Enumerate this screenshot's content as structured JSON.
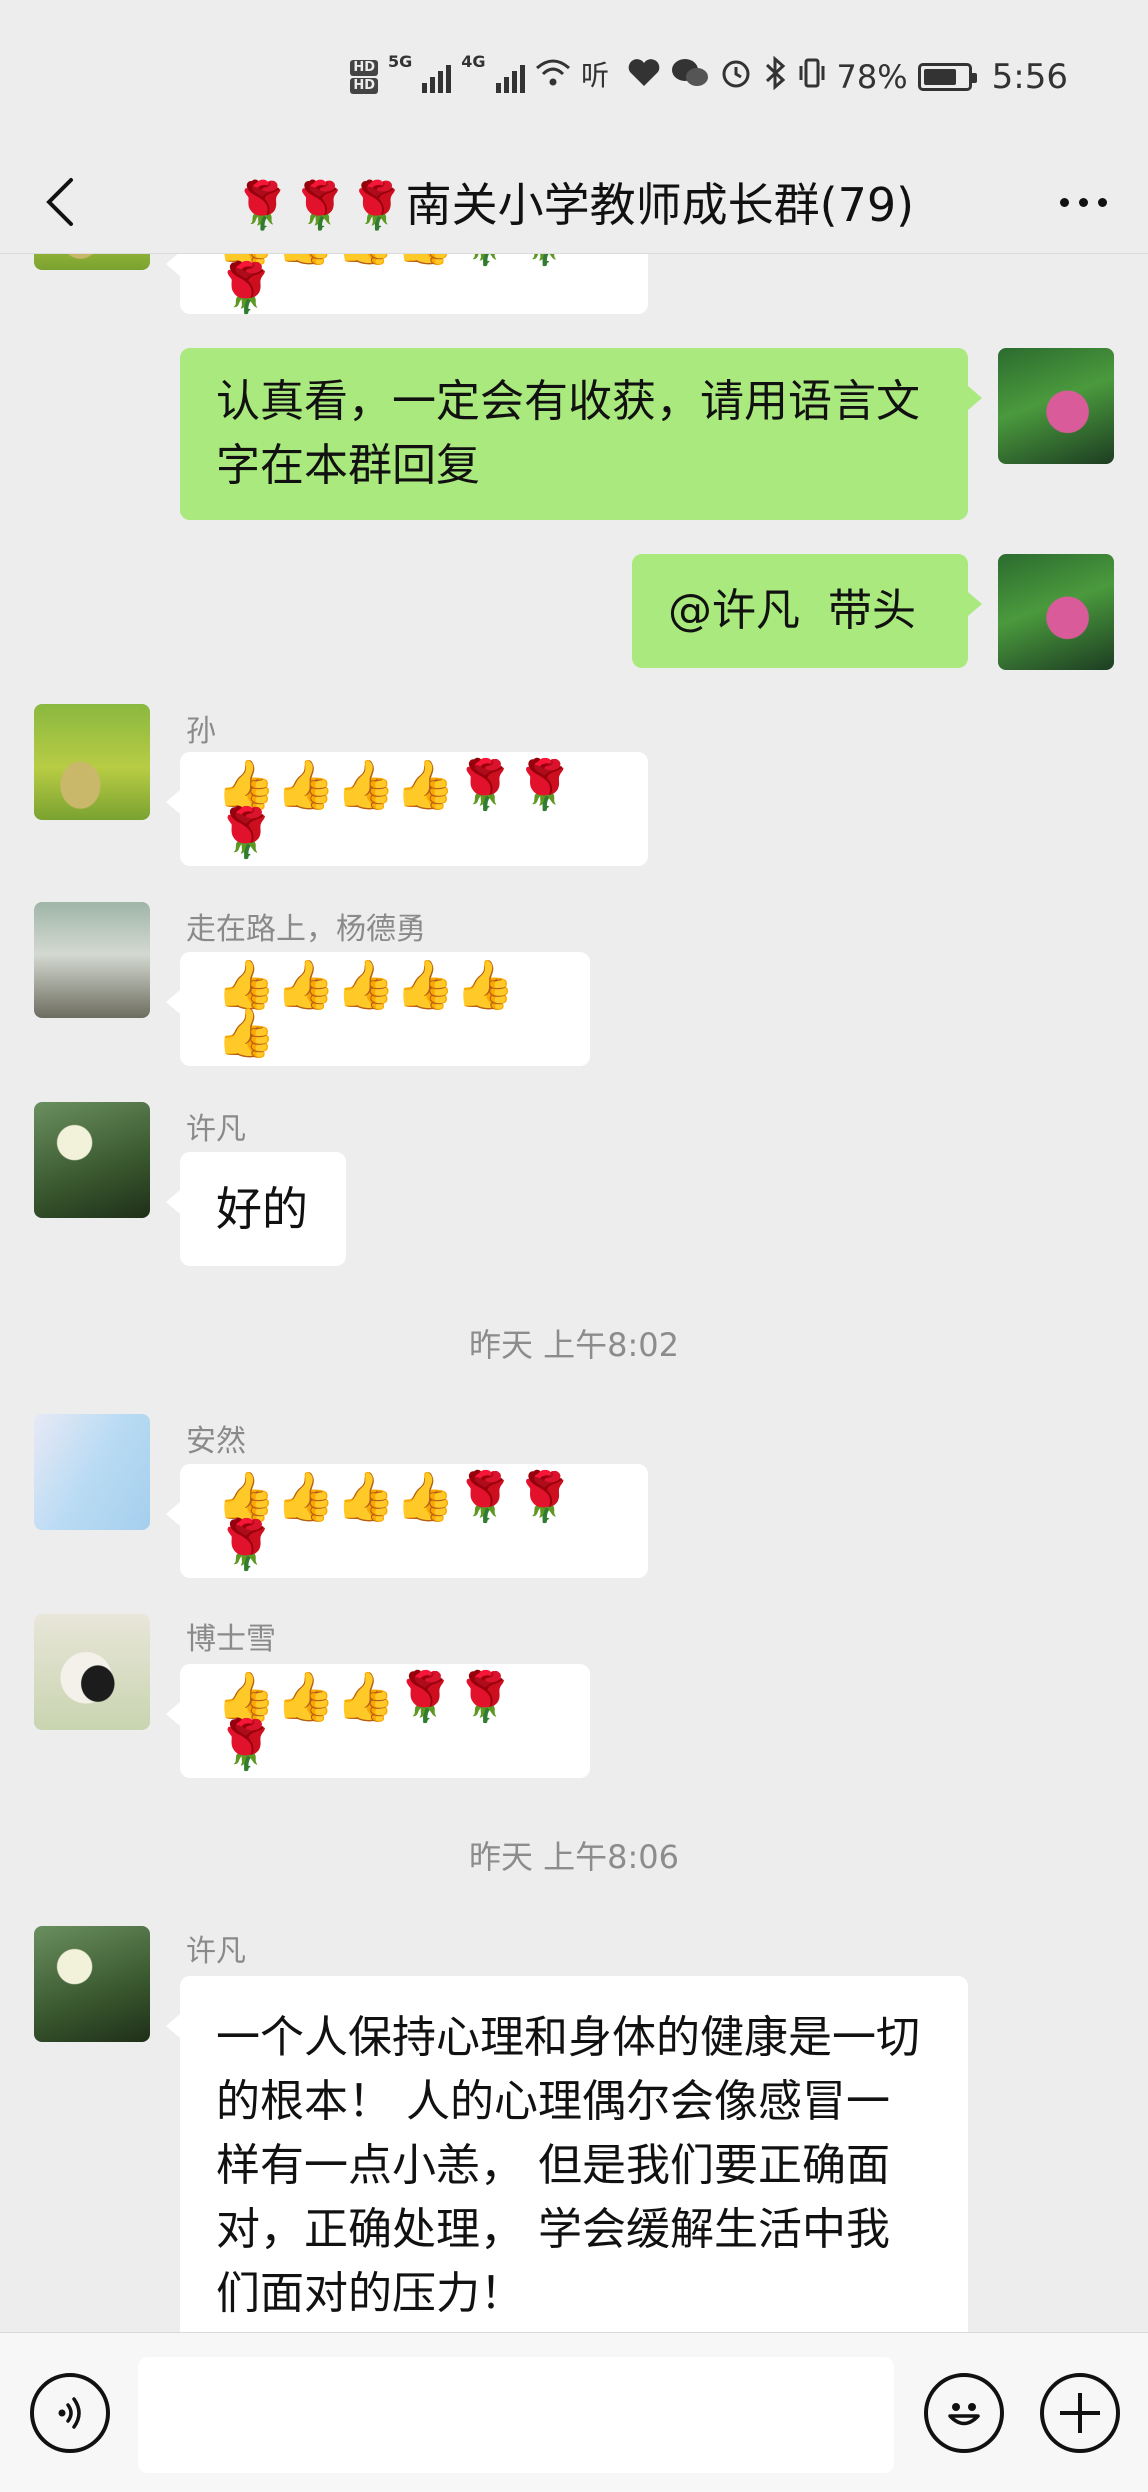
{
  "status_bar": {
    "network_1": "5G",
    "network_2": "4G",
    "battery_percent": "78%",
    "battery_level": 0.78,
    "time": "5:56"
  },
  "nav": {
    "title": "🌹🌹🌹南关小学教师成长群(79)"
  },
  "messages": [
    {
      "id": "partial-top",
      "side": "left",
      "content": "👍👍👍👍🌹🌹🌹"
    },
    {
      "id": "mine-1",
      "side": "right",
      "content": "认真看，一定会有收获，请用语言文字在本群回复"
    },
    {
      "id": "mine-2",
      "side": "right",
      "content": "@许凡  带头"
    },
    {
      "id": "sun",
      "side": "left",
      "sender": "孙",
      "content": "👍👍👍👍🌹🌹🌹"
    },
    {
      "id": "yang",
      "side": "left",
      "sender": "走在路上，杨德勇",
      "content": "👍👍👍👍👍👍"
    },
    {
      "id": "xufan-1",
      "side": "left",
      "sender": "许凡",
      "content": "好的"
    },
    {
      "id": "anran",
      "side": "left",
      "sender": "安然",
      "content": "👍👍👍👍🌹🌹🌹"
    },
    {
      "id": "boshixue",
      "side": "left",
      "sender": "博士雪",
      "content": "👍👍👍🌹🌹🌹"
    },
    {
      "id": "xufan-2",
      "side": "left",
      "sender": "许凡",
      "content": "一个人保持心理和身体的健康是一切的根本！ 人的心理偶尔会像感冒一样有一点小恙， 但是我们要正确面对，正确处理， 学会缓解生活中我们面对的压力！"
    }
  ],
  "timestamps": {
    "t1": "昨天 上午8:02",
    "t2": "昨天 上午8:06"
  },
  "input": {
    "value": "",
    "placeholder": ""
  },
  "icons": {
    "back": "chevron-left-icon",
    "more": "more-dots-icon",
    "voice": "voice-icon",
    "emoji": "emoji-icon",
    "plus": "plus-icon"
  },
  "colors": {
    "background": "#ededed",
    "my_bubble": "#a9e97d",
    "other_bubble": "#ffffff"
  }
}
